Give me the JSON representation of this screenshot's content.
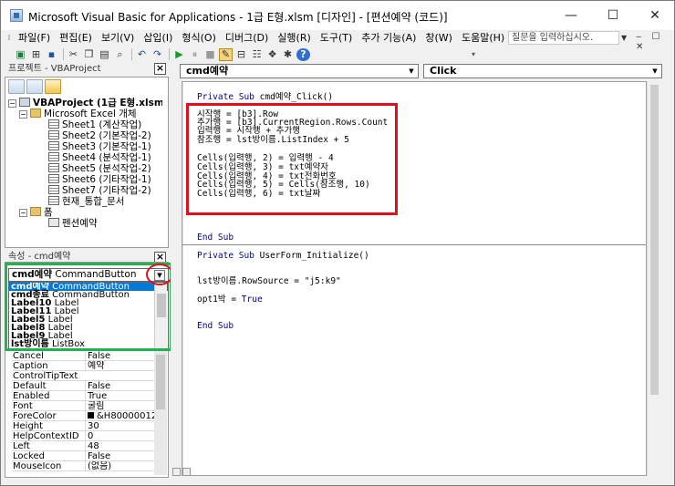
{
  "window": {
    "title": "Microsoft Visual Basic for Applications - 1급 E형.xlsm [디자인] - [편션예약 (코드)]",
    "min_glyph": "—",
    "max_glyph": "☐",
    "close_glyph": "✕"
  },
  "menubar": {
    "items": [
      "파일(F)",
      "편집(E)",
      "보기(V)",
      "삽입(I)",
      "형식(O)",
      "디버그(D)",
      "실행(R)",
      "도구(T)",
      "추가 기능(A)",
      "창(W)",
      "도움말(H)"
    ],
    "help_placeholder": "질문을 입력하십시오.",
    "mdi_buttons": "‒ ☐ ✕"
  },
  "project": {
    "title": "프로젝트 - VBAProject",
    "tree": [
      {
        "text": "VBAProject (1급 E형.xlsm)",
        "bold": true
      },
      {
        "text": "Microsoft Excel 개체"
      },
      {
        "text": "Sheet1 (계산작업)"
      },
      {
        "text": "Sheet2 (기본작업-2)"
      },
      {
        "text": "Sheet3 (기본작업-1)"
      },
      {
        "text": "Sheet4 (분석작업-1)"
      },
      {
        "text": "Sheet5 (분석작업-2)"
      },
      {
        "text": "Sheet6 (기타작업-1)"
      },
      {
        "text": "Sheet7 (기타작업-2)"
      },
      {
        "text": "현재_통합_문서"
      },
      {
        "text": "폼"
      },
      {
        "text": "펜션예약"
      }
    ]
  },
  "properties": {
    "title": "속성 - cmd예약",
    "selected_name": "cmd예약",
    "selected_type": "CommandButton",
    "list": [
      {
        "name": "cmd예약",
        "type": "CommandButton",
        "selected": true
      },
      {
        "name": "cmd종료",
        "type": "CommandButton"
      },
      {
        "name": "Label10",
        "type": "Label"
      },
      {
        "name": "Label11",
        "type": "Label"
      },
      {
        "name": "Label5",
        "type": "Label"
      },
      {
        "name": "Label8",
        "type": "Label"
      },
      {
        "name": "Label9",
        "type": "Label"
      },
      {
        "name": "lst방이름",
        "type": "ListBox"
      }
    ],
    "rows": [
      {
        "name": "Cancel",
        "value": "False"
      },
      {
        "name": "Caption",
        "value": "예약"
      },
      {
        "name": "ControlTipText",
        "value": ""
      },
      {
        "name": "Default",
        "value": "False"
      },
      {
        "name": "Enabled",
        "value": "True"
      },
      {
        "name": "Font",
        "value": "굴림"
      },
      {
        "name": "ForeColor",
        "value": "&H80000012&"
      },
      {
        "name": "Height",
        "value": "30"
      },
      {
        "name": "HelpContextID",
        "value": "0"
      },
      {
        "name": "Left",
        "value": "48"
      },
      {
        "name": "Locked",
        "value": "False"
      },
      {
        "name": "MouseIcon",
        "value": "(없음)"
      }
    ]
  },
  "code": {
    "object_dropdown": "cmd예약",
    "procedure_dropdown": "Click",
    "lines": [
      {
        "kw": "Private Sub ",
        "rest": "cmd예약_Click()"
      },
      {
        "kw": "",
        "rest": ""
      },
      {
        "kw": "",
        "rest": "시작행 = [b3].Row"
      },
      {
        "kw": "",
        "rest": "추가행 = [b3].CurrentRegion.Rows.Count"
      },
      {
        "kw": "",
        "rest": "입력행 = 시작행 + 추가행"
      },
      {
        "kw": "",
        "rest": "참조행 = lst방이름.ListIndex + 5"
      },
      {
        "kw": "",
        "rest": ""
      },
      {
        "kw": "",
        "rest": "Cells(입력행, 2) = 입력행 - 4"
      },
      {
        "kw": "",
        "rest": "Cells(입력행, 3) = txt예약자"
      },
      {
        "kw": "",
        "rest": "Cells(입력행, 4) = txt전화번호"
      },
      {
        "kw": "",
        "rest": "Cells(입력행, 5) = Cells(참조행, 10)"
      },
      {
        "kw": "",
        "rest": "Cells(입력행, 6) = txt날짜"
      }
    ],
    "end1": "End Sub",
    "sub2": {
      "kw": "Private Sub ",
      "rest": "UserForm_Initialize()"
    },
    "line2a": "lst방이름.RowSource = \"j5:k9\"",
    "line2b_pre": "opt1박 = ",
    "line2b_kw": "True",
    "end2": "End Sub"
  },
  "colors": {
    "highlight_red": "#e0101c",
    "highlight_green": "#22b14c",
    "selection_blue": "#0078d7",
    "keyword_blue": "#00008b"
  }
}
